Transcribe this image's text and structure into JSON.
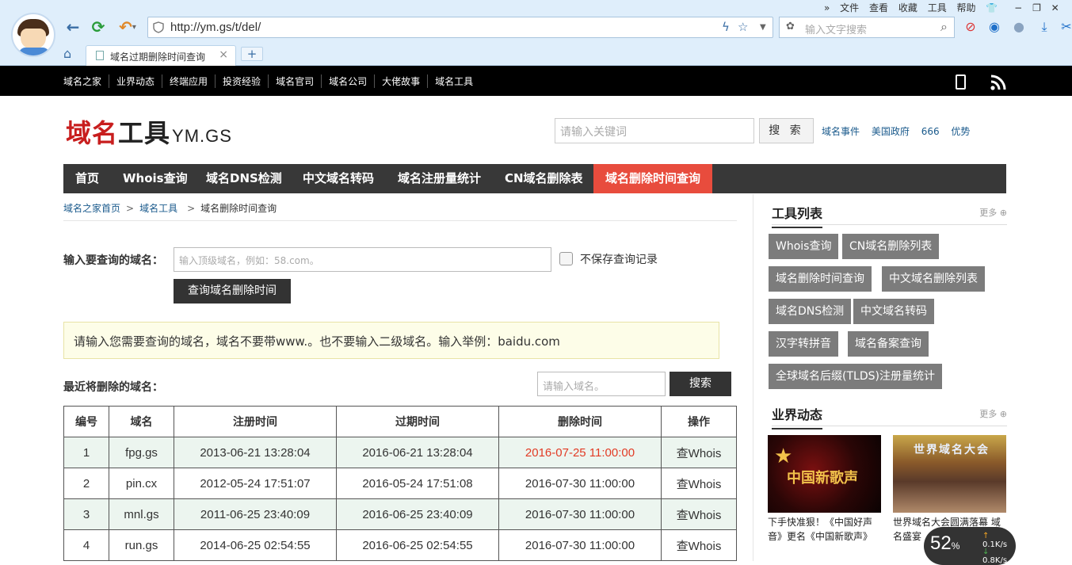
{
  "browser": {
    "url_scheme": "http://",
    "url_host": "ym.gs",
    "url_path": "/t/del/",
    "search_placeholder": "输入文字搜索",
    "menu": [
      "»",
      "文件",
      "查看",
      "收藏",
      "工具",
      "帮助"
    ],
    "tab_title": "域名过期删除时间查询",
    "tab_close": "×",
    "new_tab": "+"
  },
  "sitebar": {
    "links": [
      "域名之家",
      "业界动态",
      "终端应用",
      "投资经验",
      "域名官司",
      "域名公司",
      "大佬故事",
      "域名工具"
    ]
  },
  "header": {
    "logo_red": "域名",
    "logo_black": "工具",
    "logo_en": "YM.GS",
    "search_placeholder": "请输入关键词",
    "search_button": "搜 索",
    "hot_links": [
      "域名事件",
      "美国政府",
      "666",
      "优势"
    ]
  },
  "mainnav": [
    "首页",
    "Whois查询",
    "域名DNS检测",
    "中文域名转码",
    "域名注册量统计",
    "CN域名删除表",
    "域名删除时间查询"
  ],
  "breadcrumb": {
    "home": "域名之家首页",
    "sep": ">",
    "tools": "域名工具",
    "current": "域名删除时间查询"
  },
  "form": {
    "label": "输入要查询的域名：",
    "placeholder": "输入顶级域名，例如：58.com。",
    "nosave_label": "不保存查询记录",
    "query_button": "查询域名删除时间"
  },
  "tip": "请输入您需要查询的域名，域名不要带www.。也不要输入二级域名。输入举例：baidu.com",
  "recent": {
    "label": "最近将删除的域名：",
    "search_placeholder": "请输入域名。",
    "search_button": "搜索"
  },
  "table": {
    "headers": [
      "编号",
      "域名",
      "注册时间",
      "过期时间",
      "删除时间",
      "操作"
    ],
    "rows": [
      {
        "no": "1",
        "domain": "fpg.gs",
        "reg": "2013-06-21 13:28:04",
        "exp": "2016-06-21 13:28:04",
        "del": "2016-07-25 11:00:00",
        "op": "查Whois"
      },
      {
        "no": "2",
        "domain": "pin.cx",
        "reg": "2012-05-24 17:51:07",
        "exp": "2016-05-24 17:51:08",
        "del": "2016-07-30 11:00:00",
        "op": "查Whois"
      },
      {
        "no": "3",
        "domain": "mnl.gs",
        "reg": "2011-06-25 23:40:09",
        "exp": "2016-06-25 23:40:09",
        "del": "2016-07-30 11:00:00",
        "op": "查Whois"
      },
      {
        "no": "4",
        "domain": "run.gs",
        "reg": "2014-06-25 02:54:55",
        "exp": "2016-06-25 02:54:55",
        "del": "2016-07-30 11:00:00",
        "op": "查Whois"
      }
    ],
    "highlight_color": "#e23b25"
  },
  "sidebar": {
    "tools_title": "工具列表",
    "more": "更多",
    "tools": [
      "Whois查询",
      "CN域名删除列表",
      "域名删除时间查询",
      "中文域名删除列表",
      "域名DNS检测",
      "中文域名转码",
      "汉字转拼音",
      "域名备案查询",
      "全球域名后缀(TLDS)注册量统计"
    ],
    "news_title": "业界动态",
    "news": [
      {
        "caption": "下手快准狠！《中国好声音》更名《中国新歌声》",
        "overlay": "中国新歌声"
      },
      {
        "caption": "世界域名大会圆满落幕 域名盛宴",
        "overlay": "世界域名大会"
      }
    ]
  },
  "speed": {
    "percent": "52",
    "unit": "%",
    "up": "0.1K/s",
    "down": "0.8K/s"
  }
}
